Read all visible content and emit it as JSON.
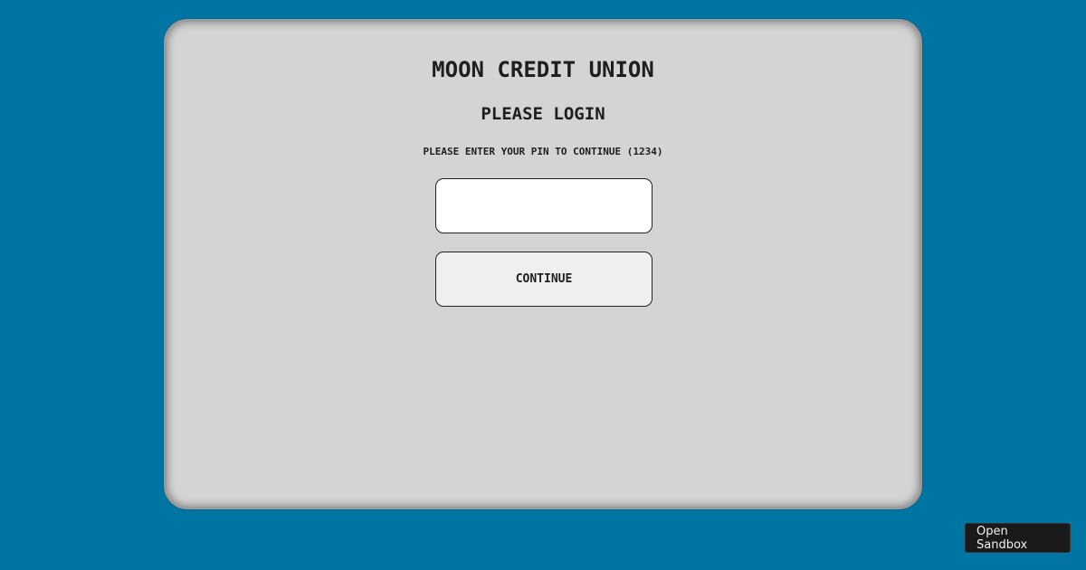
{
  "atm": {
    "bank_name": "MOON CREDIT UNION",
    "heading": "PLEASE LOGIN",
    "instruction": "PLEASE ENTER YOUR PIN TO CONTINUE (1234)",
    "pin_value": "",
    "continue_label": "CONTINUE"
  },
  "sandbox": {
    "label": "Open Sandbox"
  },
  "colors": {
    "background": "#0074a2",
    "screen": "#d4d4d4",
    "text": "#1e1e1e",
    "button": "#efefef",
    "sandbox_button": "#1a1a1a"
  }
}
